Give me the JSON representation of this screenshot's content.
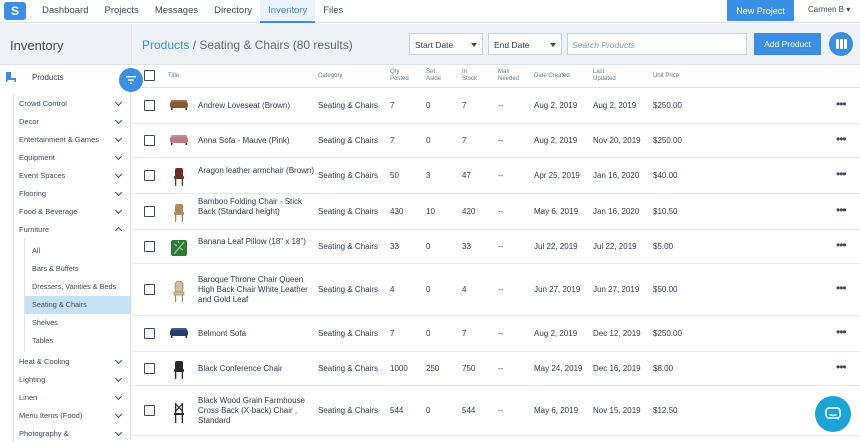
{
  "nav": {
    "logo": "S",
    "items": [
      "Dashboard",
      "Projects",
      "Messages",
      "Directory",
      "Inventory",
      "Files"
    ],
    "active": "Inventory",
    "new_project": "New Project",
    "user": "Carmen B ▾"
  },
  "header": {
    "section_title": "Inventory",
    "breadcrumb_link": "Products",
    "breadcrumb_rest": " / Seating & Chairs (80 results)",
    "start_date": "Start Date",
    "end_date": "End Date",
    "search_placeholder": "Search Products",
    "add_product": "Add Product"
  },
  "sidebar": {
    "products_label": "Products",
    "categories_top": [
      "Crowd Control",
      "Decor",
      "Entertainment & Games",
      "Equipment",
      "Event Spaces",
      "Flooring",
      "Food & Beverage"
    ],
    "furniture": "Furniture",
    "furniture_subs": [
      "All",
      "Bars & Buffets",
      "Dressers, Vanities & Beds",
      "Seating & Chairs",
      "Shelves",
      "Tables"
    ],
    "active_sub": "Seating & Chairs",
    "categories_bottom": [
      "Heat & Cooling",
      "Lighting",
      "Linen",
      "Menu Items (Food)",
      "Photography &"
    ]
  },
  "table": {
    "headers": {
      "title": "Title",
      "category": "Category",
      "qty": "Qty\nPosted",
      "aside": "Set\nAside",
      "stock": "In\nStock",
      "needed": "Max\nNeeded",
      "created": "Date Created",
      "updated": "Last\nUpdated",
      "price": "Unit Price"
    },
    "rows": [
      {
        "title": "Andrew Loveseat (Brown)",
        "category": "Seating & Chairs",
        "qty": "7",
        "aside": "0",
        "stock": "7",
        "needed": "--",
        "created": "Aug 2, 2019",
        "updated": "Aug 2, 2019",
        "price": "$250.00",
        "thumb": "sofa",
        "color": "#8a5a2c"
      },
      {
        "title": "Anna Sofa - Mauve (Pink)",
        "category": "Seating & Chairs",
        "qty": "7",
        "aside": "0",
        "stock": "7",
        "needed": "--",
        "created": "Aug 2, 2019",
        "updated": "Nov 20, 2019",
        "price": "$250.00",
        "thumb": "sofa",
        "color": "#c07a7e"
      },
      {
        "title": "Aragon leather armchair (Brown)",
        "category": "Seating & Chairs",
        "qty": "50",
        "aside": "3",
        "stock": "47",
        "needed": "--",
        "created": "Apr 25, 2019",
        "updated": "Jan 16, 2020",
        "price": "$40.00",
        "thumb": "chair",
        "color": "#6e2e22"
      },
      {
        "title": "Bamboo Folding Chair - Stick Back (Standard height)",
        "category": "Seating & Chairs",
        "qty": "430",
        "aside": "10",
        "stock": "420",
        "needed": "--",
        "created": "May 6, 2019",
        "updated": "Jan 16, 2020",
        "price": "$10.50",
        "thumb": "chair",
        "color": "#b08a58"
      },
      {
        "title": "Banana Leaf Pillow (18\" x 18\")",
        "category": "Seating & Chairs",
        "qty": "33",
        "aside": "0",
        "stock": "33",
        "needed": "--",
        "created": "Jul 22, 2019",
        "updated": "Jul 22, 2019",
        "price": "$5.00",
        "thumb": "leaf",
        "color": "#2f7a3a"
      },
      {
        "title": "Baroque Throne Chair Queen High Back Chair White Leather and Gold Leaf",
        "category": "Seating & Chairs",
        "qty": "4",
        "aside": "0",
        "stock": "4",
        "needed": "--",
        "created": "Jun 27, 2019",
        "updated": "Jun 27, 2019",
        "price": "$50.00",
        "thumb": "throne",
        "color": "#cdbfa8"
      },
      {
        "title": "Belmont Sofa",
        "category": "Seating & Chairs",
        "qty": "7",
        "aside": "0",
        "stock": "7",
        "needed": "--",
        "created": "Aug 2, 2019",
        "updated": "Dec 12, 2019",
        "price": "$250.00",
        "thumb": "sofa",
        "color": "#243e6e"
      },
      {
        "title": "Black Conference Chair",
        "category": "Seating & Chairs",
        "qty": "1000",
        "aside": "250",
        "stock": "750",
        "needed": "--",
        "created": "May 24, 2019",
        "updated": "Dec 16, 2019",
        "price": "$8.00",
        "thumb": "chair",
        "color": "#2a2a2a"
      },
      {
        "title": "Black Wood Grain Farmhouse Cross Back (X-back) Chair , Standard",
        "category": "Seating & Chairs",
        "qty": "544",
        "aside": "0",
        "stock": "544",
        "needed": "--",
        "created": "May 6, 2019",
        "updated": "Nov 15, 2019",
        "price": "$12.50",
        "thumb": "xchair",
        "color": "#2a2a2a"
      }
    ]
  },
  "colors": {
    "accent": "#3a8ee6",
    "chat": "#1aa3d6",
    "active_sub_bg": "#c6e0f5"
  },
  "icons": [
    "logo-icon",
    "product-icon",
    "filter-icon",
    "columns-icon",
    "more-icon",
    "chat-icon",
    "chevron-down-icon",
    "chevron-up-icon"
  ]
}
